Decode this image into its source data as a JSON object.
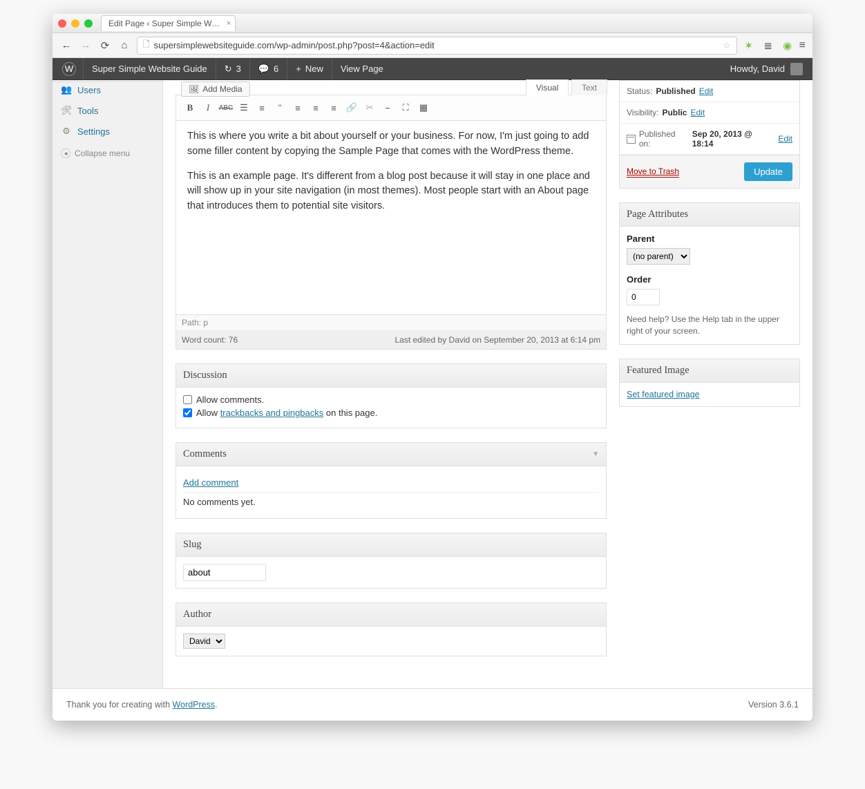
{
  "browser": {
    "tab_title": "Edit Page ‹ Super Simple W…",
    "url": "supersimplewebsiteguide.com/wp-admin/post.php?post=4&action=edit"
  },
  "adminbar": {
    "site_title": "Super Simple Website Guide",
    "updates_count": "3",
    "comments_count": "6",
    "new_label": "New",
    "view_label": "View Page",
    "howdy": "Howdy, David"
  },
  "sidebar": {
    "users": "Users",
    "tools": "Tools",
    "settings": "Settings",
    "collapse": "Collapse menu"
  },
  "editor": {
    "add_media": "Add Media",
    "tabs": {
      "visual": "Visual",
      "text": "Text"
    },
    "content_p1": "This is where you write a bit about yourself or your business. For now, I'm just going to add some filler content by copying the Sample Page that comes with the WordPress theme.",
    "content_p2": "This is an example page. It's different from a blog post because it will stay in one place and will show up in your site navigation (in most themes). Most people start with an About page that introduces them to potential site visitors.",
    "path": "Path: p",
    "word_count": "Word count: 76",
    "last_edited": "Last edited by David on September 20, 2013 at 6:14 pm"
  },
  "discussion": {
    "title": "Discussion",
    "allow_comments": "Allow comments.",
    "allow_before": "Allow ",
    "trackbacks_link": "trackbacks and pingbacks",
    "allow_after": " on this page."
  },
  "comments": {
    "title": "Comments",
    "add": "Add comment",
    "none": "No comments yet."
  },
  "slug": {
    "title": "Slug",
    "value": "about"
  },
  "author": {
    "title": "Author",
    "value": "David"
  },
  "publish": {
    "status_label": "Status:",
    "status_value": "Published",
    "visibility_label": "Visibility:",
    "visibility_value": "Public",
    "published_label": "Published on:",
    "published_value": "Sep 20, 2013 @ 18:14",
    "edit": "Edit",
    "trash": "Move to Trash",
    "update": "Update"
  },
  "attributes": {
    "title": "Page Attributes",
    "parent_label": "Parent",
    "parent_value": "(no parent)",
    "order_label": "Order",
    "order_value": "0",
    "help": "Need help? Use the Help tab in the upper right of your screen."
  },
  "featured": {
    "title": "Featured Image",
    "set": "Set featured image"
  },
  "footer": {
    "thanks_before": "Thank you for creating with ",
    "wp": "WordPress",
    "thanks_after": ".",
    "version": "Version 3.6.1"
  }
}
